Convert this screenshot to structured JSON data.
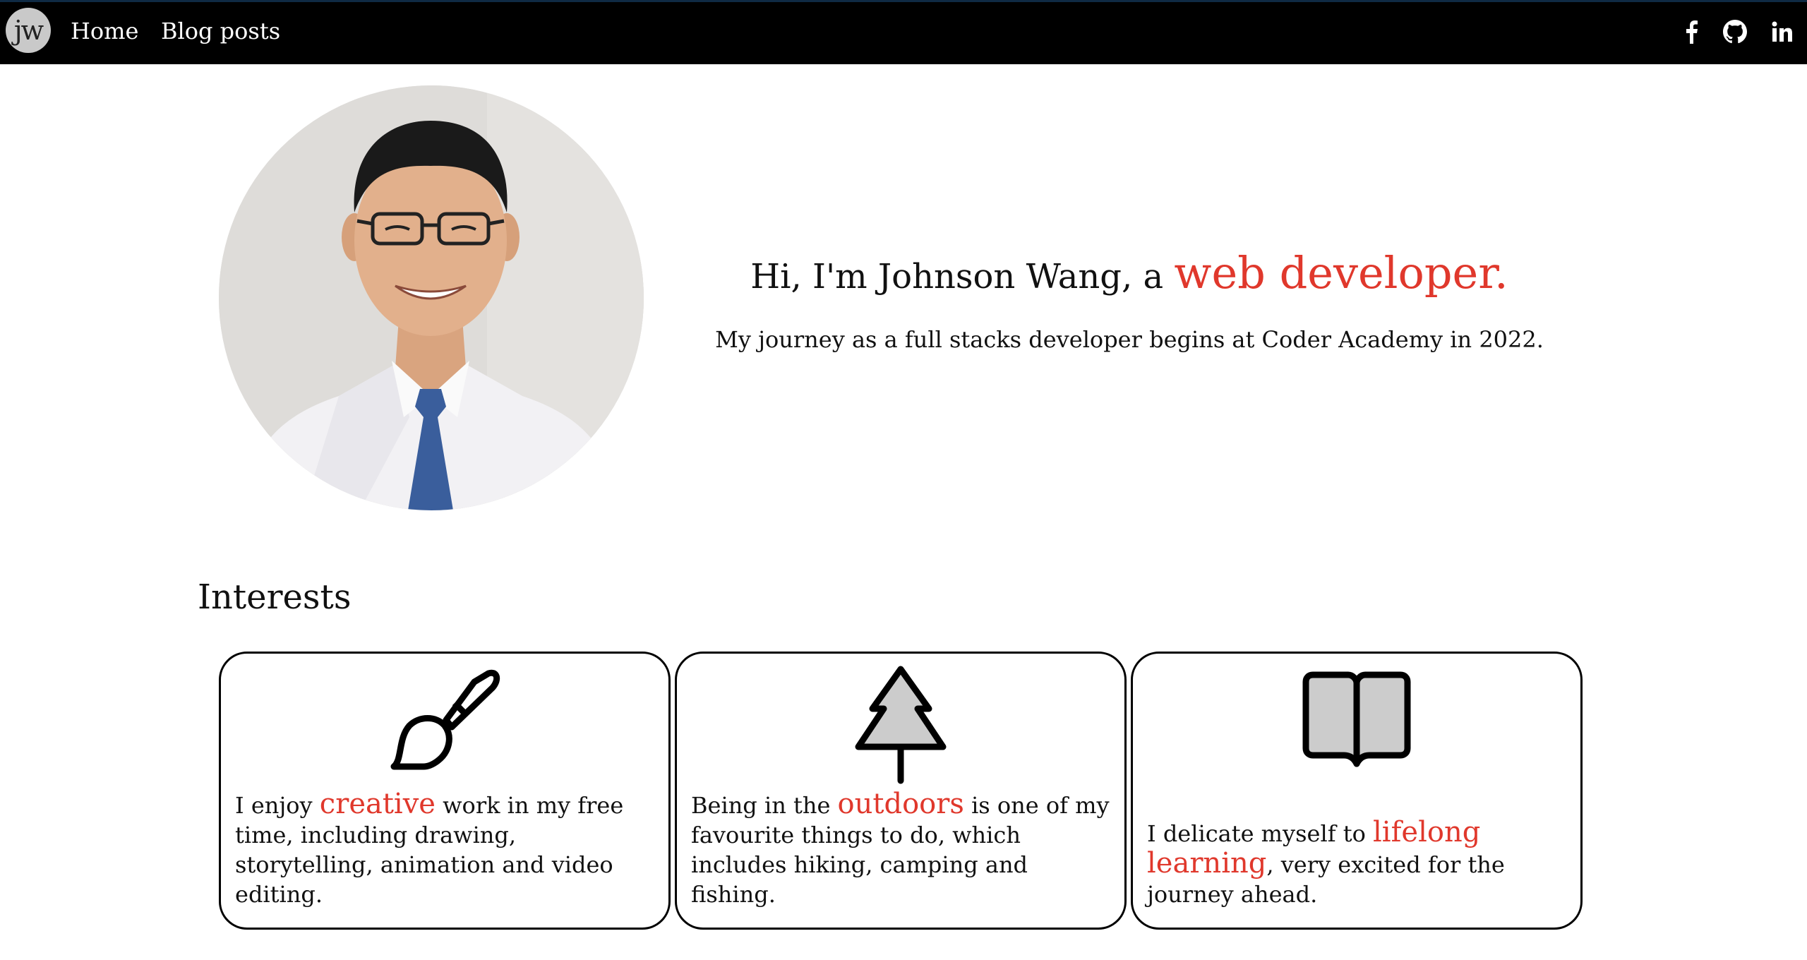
{
  "brand": {
    "logo_text": "jw"
  },
  "nav": {
    "home_label": "Home",
    "blog_label": "Blog posts"
  },
  "social": [
    {
      "icon": "facebook-icon"
    },
    {
      "icon": "github-icon"
    },
    {
      "icon": "linkedin-icon"
    }
  ],
  "hero": {
    "greeting": "Hi, I'm Johnson Wang, a ",
    "highlight": "web developer.",
    "subtitle": "My journey as a full stacks developer begins at Coder Academy in 2022."
  },
  "interests": {
    "heading": "Interests",
    "cards": [
      {
        "icon": "paintbrush-icon",
        "before": "I enjoy ",
        "highlight": "creative",
        "after": " work in my free time, including drawing, storytelling, animation and video editing."
      },
      {
        "icon": "tree-icon",
        "before": "Being in the ",
        "highlight": "outdoors",
        "after": " is one of my favourite things to do, which includes hiking, camping and fishing."
      },
      {
        "icon": "open-book-icon",
        "before": "I delicate myself to ",
        "highlight": "lifelong learning",
        "after": ", very excited for the journey ahead."
      }
    ]
  },
  "colors": {
    "accent": "#e0382c",
    "navbar_bg": "#000000",
    "icon_fill": "#cccccc"
  }
}
